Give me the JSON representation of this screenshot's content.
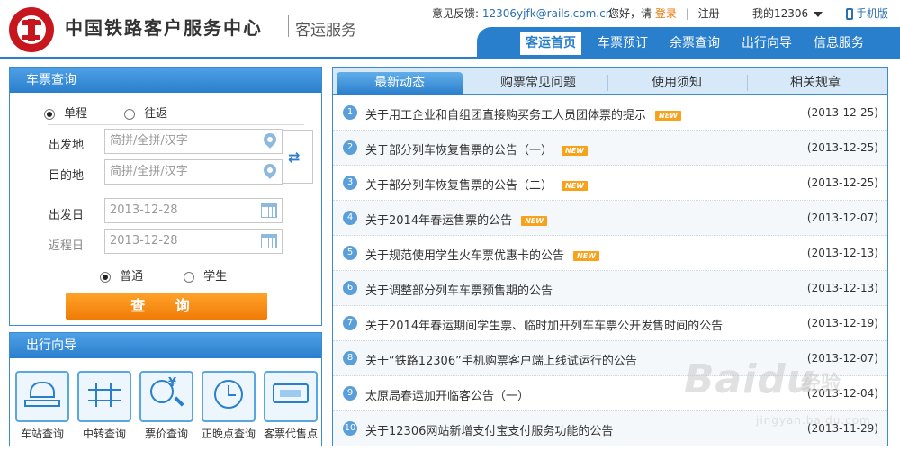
{
  "header": {
    "brand": "中国铁路客户服务中心",
    "sub": "客运服务",
    "feedback_label": "意见反馈:",
    "feedback_email": "12306yjfk@rails.com.cn",
    "greeting": "您好，请",
    "login": "登录",
    "register": "注册",
    "my12306": "我的12306",
    "mobile": "手机版"
  },
  "nav": {
    "items": [
      "客运首页",
      "车票预订",
      "余票查询",
      "出行向导",
      "信息服务"
    ],
    "active": "客运首页"
  },
  "ticket": {
    "title": "车票查询",
    "trip_types": [
      "单程",
      "往返"
    ],
    "from_label": "出发地",
    "to_label": "目的地",
    "from_placeholder": "简拼/全拼/汉字",
    "to_placeholder": "简拼/全拼/汉字",
    "depart_label": "出发日",
    "return_label": "返程日",
    "depart_date": "2013-12-28",
    "return_date": "2013-12-28",
    "passenger_types": [
      "普通",
      "学生"
    ],
    "search": "查 询"
  },
  "guide": {
    "title": "出行向导",
    "items": [
      "车站查询",
      "中转查询",
      "票价查询",
      "正晚点查询",
      "客票代售点"
    ]
  },
  "news": {
    "tabs": [
      "最新动态",
      "购票常见问题",
      "使用须知",
      "相关规章"
    ],
    "new_badge": "NEW",
    "items": [
      {
        "n": "1",
        "title": "关于用工企业和自组团直接购买务工人员团体票的提示",
        "date": "(2013-12-25)",
        "new": true
      },
      {
        "n": "2",
        "title": "关于部分列车恢复售票的公告（一）",
        "date": "(2013-12-25)",
        "new": true
      },
      {
        "n": "3",
        "title": "关于部分列车恢复售票的公告（二）",
        "date": "(2013-12-25)",
        "new": true
      },
      {
        "n": "4",
        "title": "关于2014年春运售票的公告",
        "date": "(2013-12-07)",
        "new": true
      },
      {
        "n": "5",
        "title": "关于规范使用学生火车票优惠卡的公告",
        "date": "(2013-12-13)",
        "new": true
      },
      {
        "n": "6",
        "title": "关于调整部分列车车票预售期的公告",
        "date": "(2013-12-13)",
        "new": false
      },
      {
        "n": "7",
        "title": "关于2014年春运期间学生票、临时加开列车车票公开发售时间的公告",
        "date": "(2013-12-19)",
        "new": false
      },
      {
        "n": "8",
        "title": "关于“铁路12306”手机购票客户端上线试运行的公告",
        "date": "(2013-12-07)",
        "new": false
      },
      {
        "n": "9",
        "title": "太原局春运加开临客公告（一）",
        "date": "(2013-12-04)",
        "new": false
      },
      {
        "n": "10",
        "title": "关于12306网站新增支付宝支付服务功能的公告",
        "date": "(2013-11-29)",
        "new": false
      }
    ]
  },
  "watermark": {
    "main": "Baidu",
    "sub": "经验",
    "url": "jingyan.baidu.com"
  },
  "colors": {
    "primary": "#2a7fcc",
    "accent": "#f07b07",
    "brand_red": "#c7161e"
  }
}
